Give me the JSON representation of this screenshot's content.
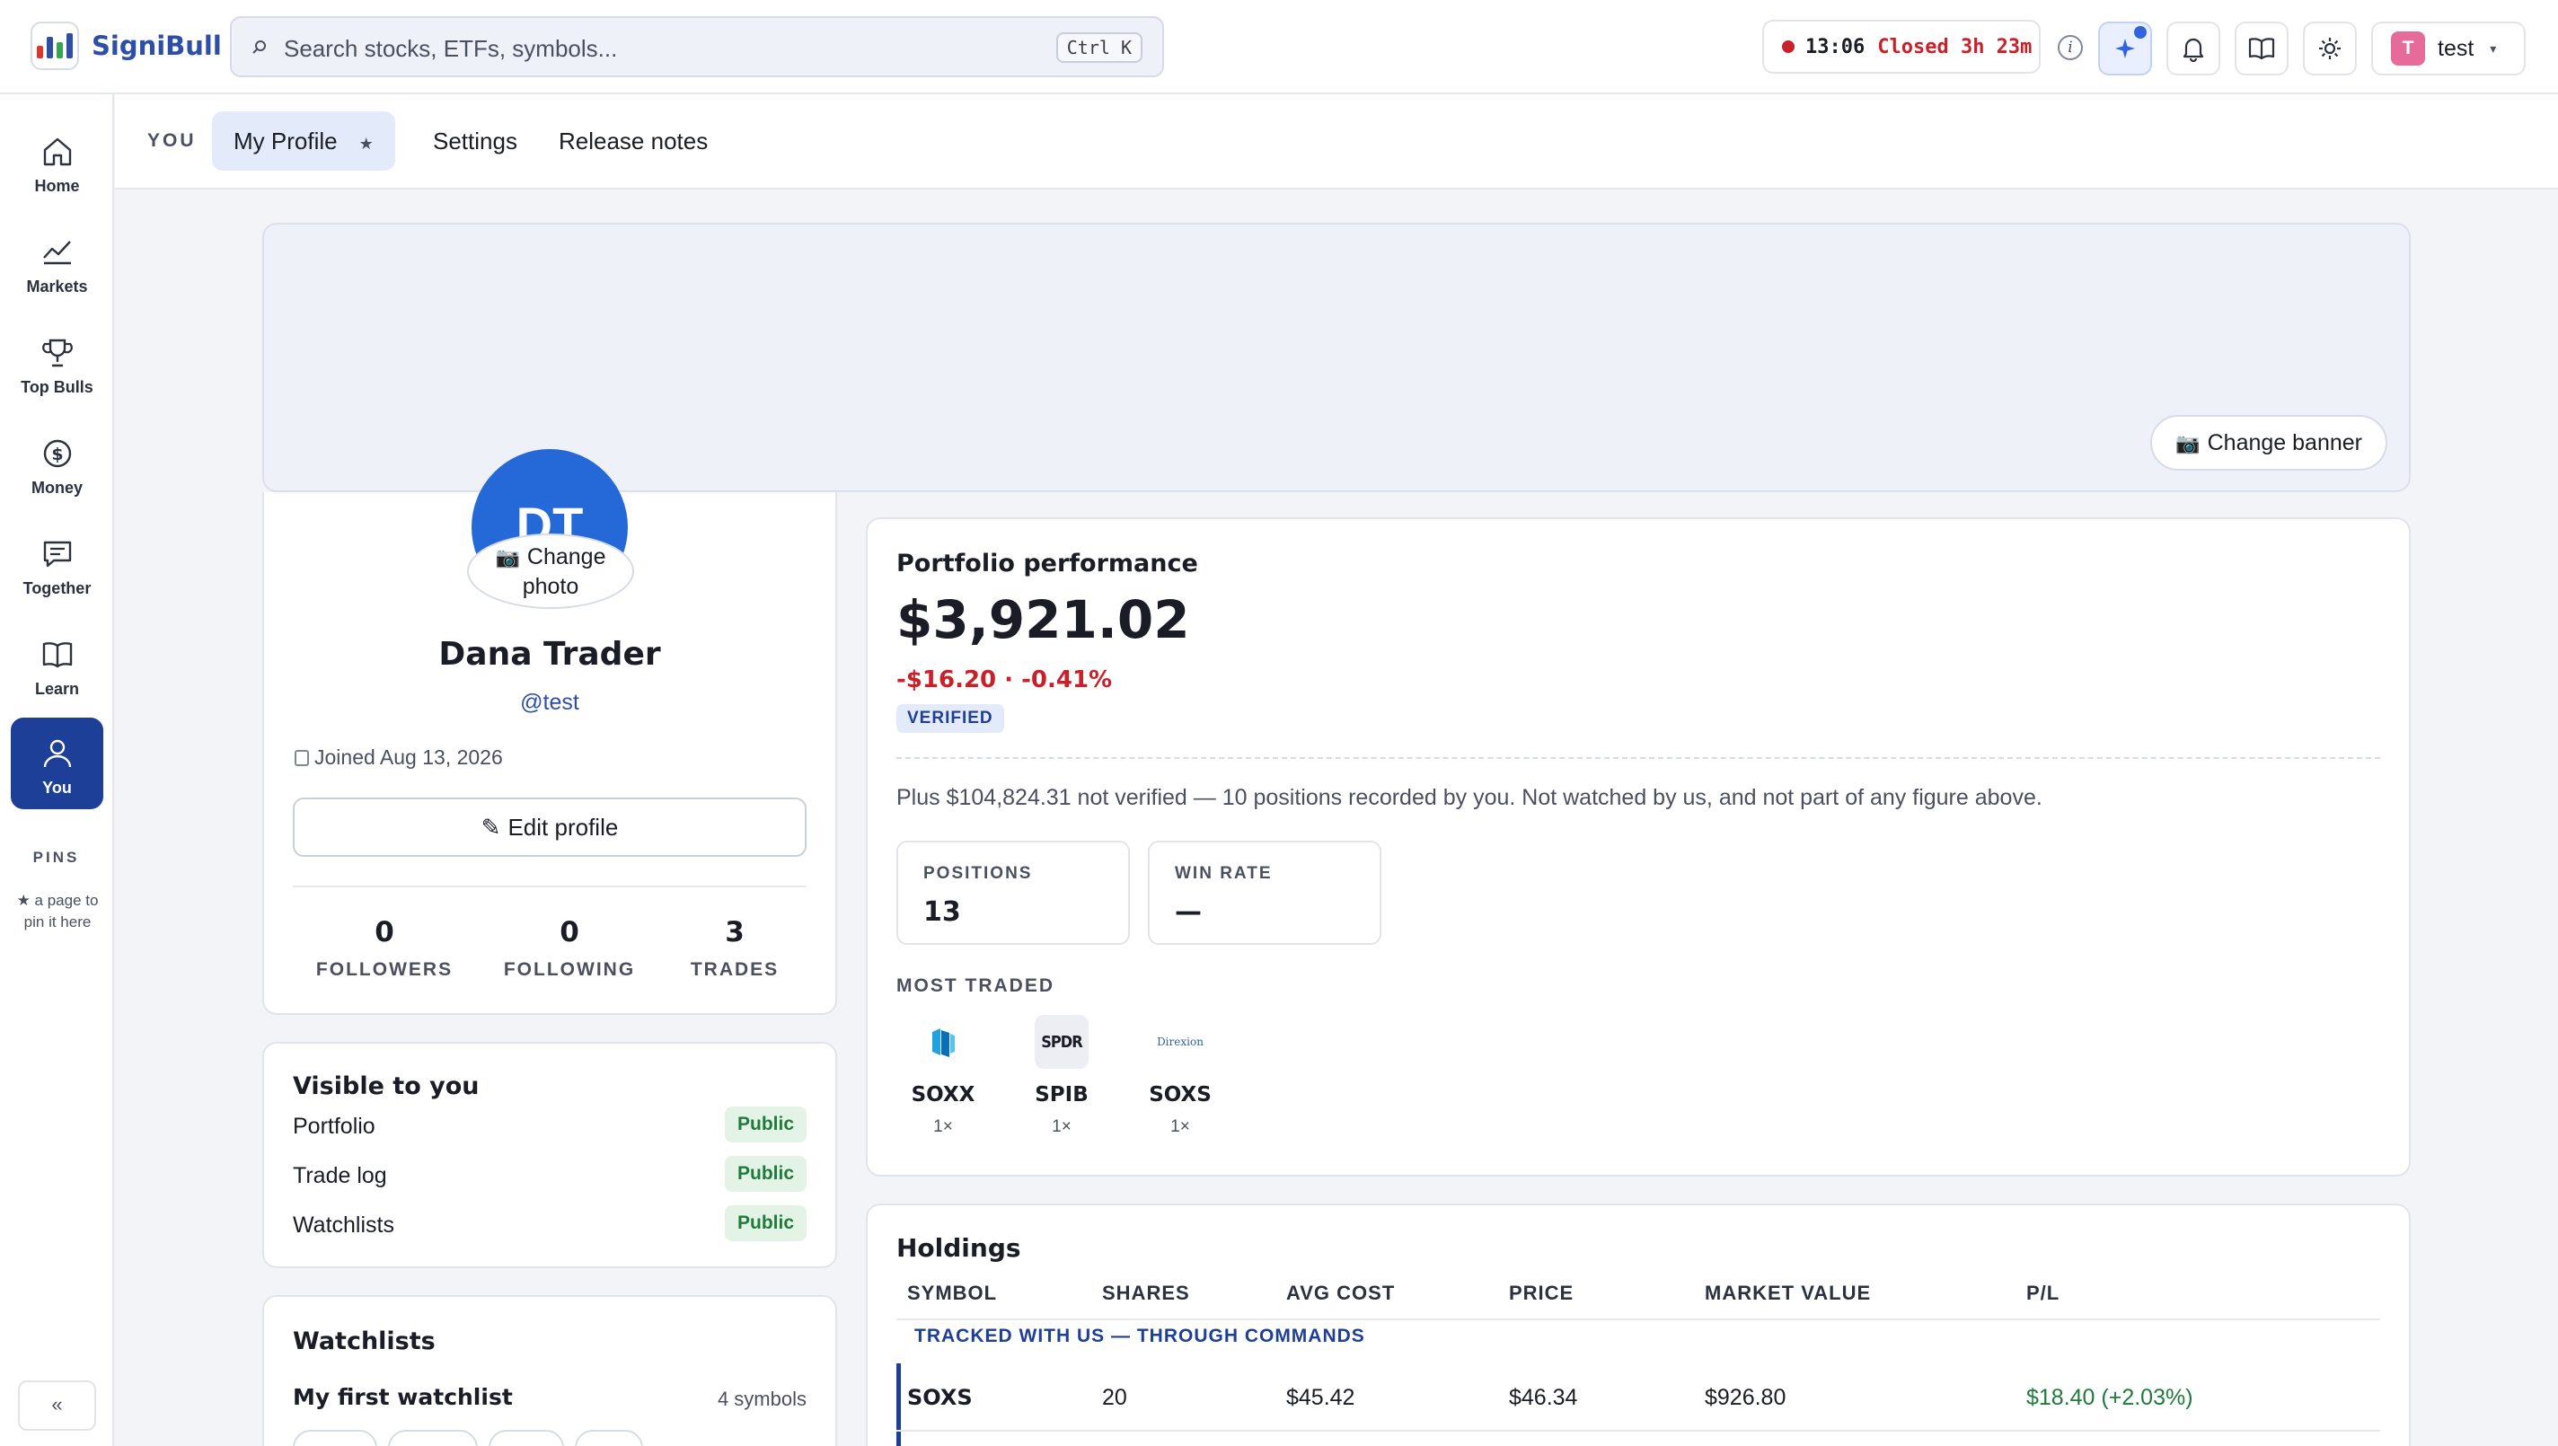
{
  "app": {
    "name": "SigniBull",
    "search_placeholder": "Search stocks, ETFs, symbols...",
    "search_shortcut": "Ctrl K",
    "market_time": "13:06",
    "market_status": "Closed 3h 23m",
    "user_initial": "T",
    "user_name": "test",
    "colors": {
      "brand": "#2e4fa8",
      "accent": "#1d3f98",
      "negative": "#c9202a",
      "positive": "#1f7a3b"
    }
  },
  "sidebar": {
    "items": [
      {
        "label": "Home",
        "icon": "home-icon"
      },
      {
        "label": "Markets",
        "icon": "chart-line-icon"
      },
      {
        "label": "Top Bulls",
        "icon": "trophy-icon"
      },
      {
        "label": "Money",
        "icon": "dollar-coin-icon"
      },
      {
        "label": "Together",
        "icon": "chat-icon"
      },
      {
        "label": "Learn",
        "icon": "book-icon"
      },
      {
        "label": "You",
        "icon": "user-icon",
        "active": true
      }
    ],
    "pins_title": "PINS",
    "pins_hint": "★ a page to pin it here",
    "collapse_label": "«"
  },
  "subnav": {
    "section": "YOU",
    "tabs": [
      {
        "label": "My Profile",
        "active": true,
        "star": "★"
      },
      {
        "label": "Settings"
      },
      {
        "label": "Release notes"
      }
    ]
  },
  "banner": {
    "change_label": "Change banner"
  },
  "profile": {
    "initials": "DT",
    "change_photo_label": "Change photo",
    "name": "Dana Trader",
    "handle": "@test",
    "joined": "Joined Aug 13, 2026",
    "edit_label": "Edit profile",
    "stats": [
      {
        "value": "0",
        "label": "FOLLOWERS"
      },
      {
        "value": "0",
        "label": "FOLLOWING"
      },
      {
        "value": "3",
        "label": "TRADES"
      }
    ]
  },
  "visibility": {
    "title": "Visible to you",
    "rows": [
      {
        "label": "Portfolio",
        "status": "Public"
      },
      {
        "label": "Trade log",
        "status": "Public"
      },
      {
        "label": "Watchlists",
        "status": "Public"
      }
    ]
  },
  "watchlists": {
    "title": "Watchlists",
    "first_name": "My first watchlist",
    "first_count": "4 symbols"
  },
  "performance": {
    "title": "Portfolio performance",
    "value": "$3,921.02",
    "change": "-$16.20 · -0.41%",
    "badge": "VERIFIED",
    "note": "Plus $104,824.31 not verified — 10 positions recorded by you. Not watched by us, and not part of any figure above.",
    "kpis": [
      {
        "label": "POSITIONS",
        "value": "13"
      },
      {
        "label": "WIN RATE",
        "value": "—"
      }
    ],
    "most_traded_title": "MOST TRADED",
    "most_traded": [
      {
        "symbol": "SOXX",
        "count": "1×",
        "logo": "ishares-logo"
      },
      {
        "symbol": "SPIB",
        "count": "1×",
        "logo": "SPDR"
      },
      {
        "symbol": "SOXS",
        "count": "1×",
        "logo": "Direxion"
      }
    ]
  },
  "holdings": {
    "title": "Holdings",
    "columns": [
      "SYMBOL",
      "SHARES",
      "AVG COST",
      "PRICE",
      "MARKET VALUE",
      "P/L"
    ],
    "group_label": "TRACKED WITH US — THROUGH COMMANDS",
    "rows": [
      {
        "symbol": "SOXS",
        "shares": "20",
        "avg_cost": "$45.42",
        "price": "$46.34",
        "market_value": "$926.80",
        "pl": "$18.40 (+2.03%)"
      }
    ]
  }
}
